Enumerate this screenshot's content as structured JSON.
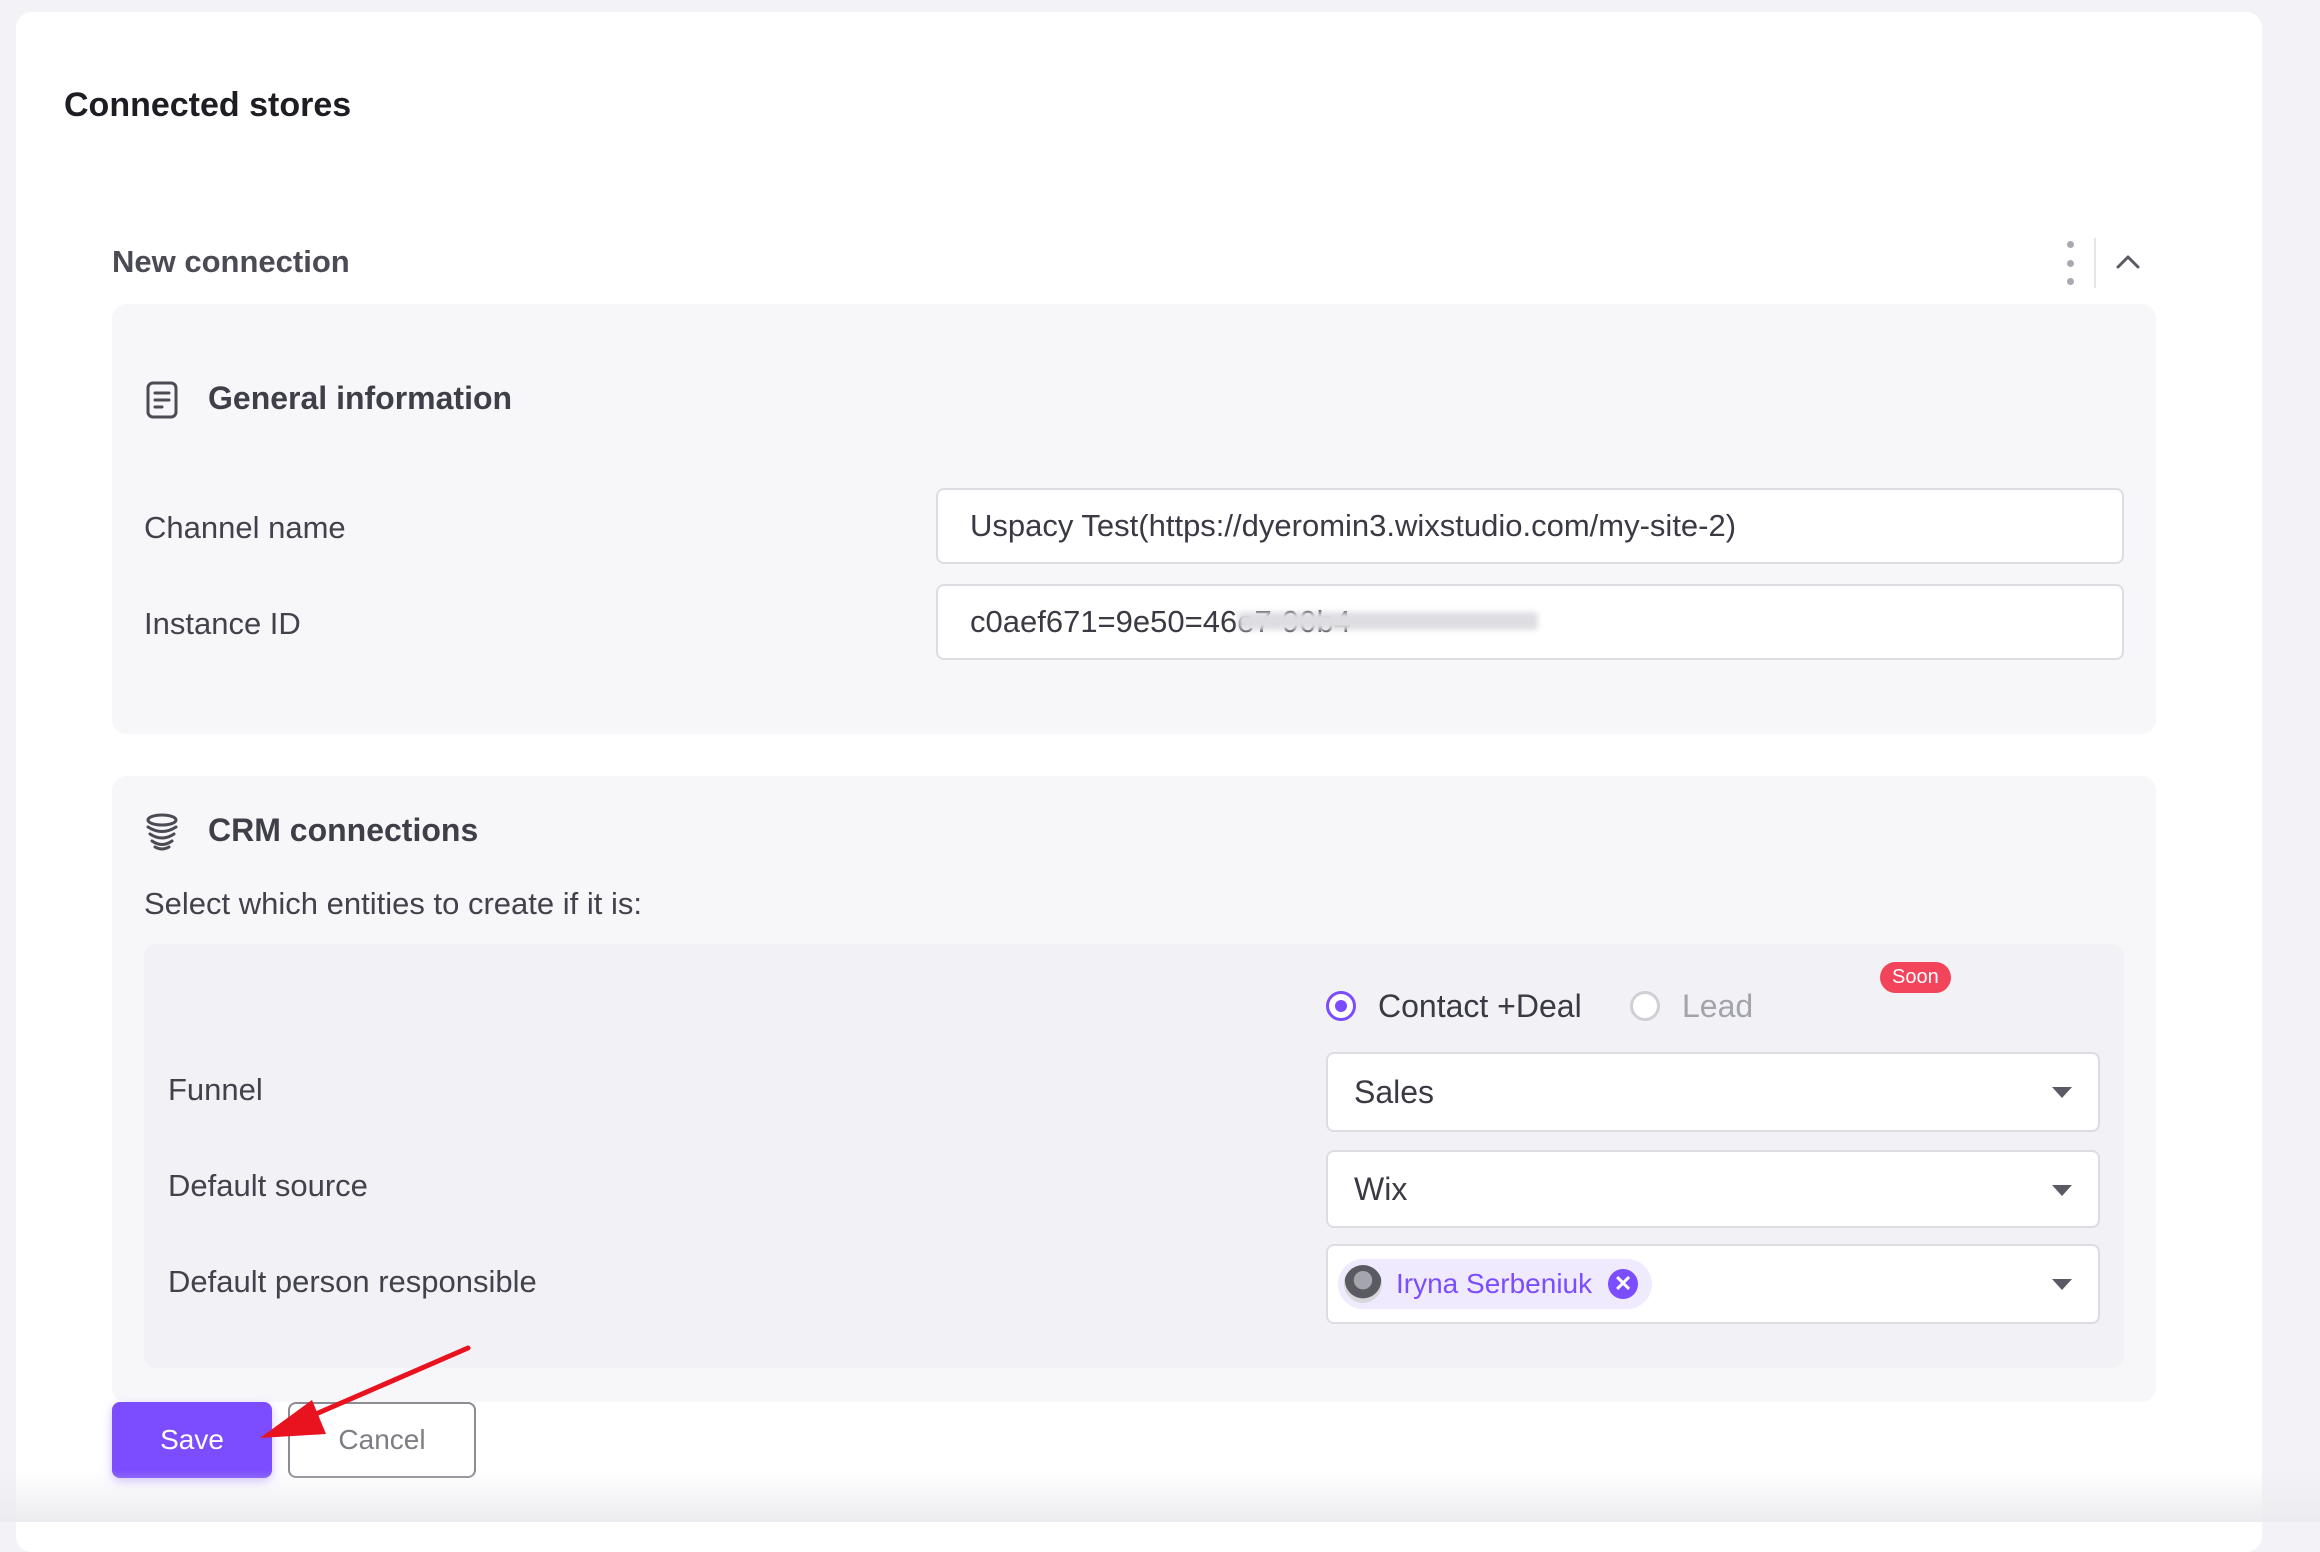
{
  "page": {
    "title": "Connected stores"
  },
  "connection": {
    "title": "New connection",
    "general": {
      "title": "General information",
      "fields": [
        {
          "label": "Channel name",
          "value": "Uspacy Test(https://dyeromin3.wixstudio.com/my-site-2)"
        },
        {
          "label": "Instance ID",
          "value": "c0aef671=9e50=46e7-90b4"
        }
      ]
    },
    "crm": {
      "title": "CRM connections",
      "description": "Select which entities to create if it is:",
      "options": [
        {
          "label": "Contact +Deal",
          "selected": true
        },
        {
          "label": "Lead",
          "selected": false,
          "badge": "Soon"
        }
      ],
      "funnel": {
        "label": "Funnel",
        "value": "Sales"
      },
      "source": {
        "label": "Default source",
        "value": "Wix"
      },
      "responsible": {
        "label": "Default person responsible",
        "person": "Iryna Serbeniuk"
      }
    }
  },
  "actions": {
    "save": "Save",
    "cancel": "Cancel"
  },
  "colors": {
    "accent": "#7b4dff",
    "badge": "#f2445b",
    "arrow": "#e8131f"
  }
}
